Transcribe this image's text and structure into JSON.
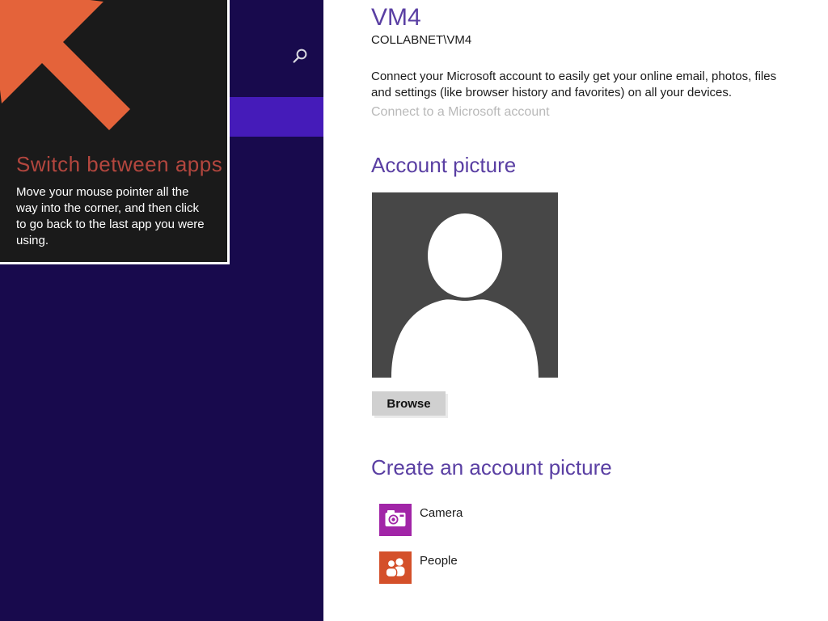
{
  "tooltip": {
    "title": "Switch between apps",
    "body_lines": [
      "Move your mouse pointer all the",
      "way into the corner, and then click",
      "to go back to the last app you were",
      "using."
    ],
    "colors": {
      "background": "#1a1a1a",
      "title": "#b2463e",
      "arrow": "#e4633a",
      "border": "#ffffff"
    }
  },
  "sidebar": {
    "colors": {
      "background": "#180a4d",
      "selected_item": "#451bb9"
    }
  },
  "main": {
    "title": "VM4",
    "subtitle": "COLLABNET\\VM4",
    "intro_lines": [
      "Connect your Microsoft account to easily get your online email, photos, files",
      "and settings (like browser history and favorites) on all your devices."
    ],
    "microsoft_link": "Connect to a Microsoft account",
    "account_picture": {
      "heading": "Account picture",
      "browse_label": "Browse"
    },
    "create_picture": {
      "heading": "Create an account picture",
      "items": [
        {
          "label": "Camera",
          "icon": "camera-icon",
          "tile_color": "#a125a7"
        },
        {
          "label": "People",
          "icon": "people-icon",
          "tile_color": "#d4502a"
        }
      ]
    },
    "colors": {
      "heading": "#5a3fa3",
      "text": "#1a1a1a",
      "muted_link": "#b9b9b9",
      "button": "#d0d0d0",
      "avatar_bg": "#474747"
    }
  }
}
